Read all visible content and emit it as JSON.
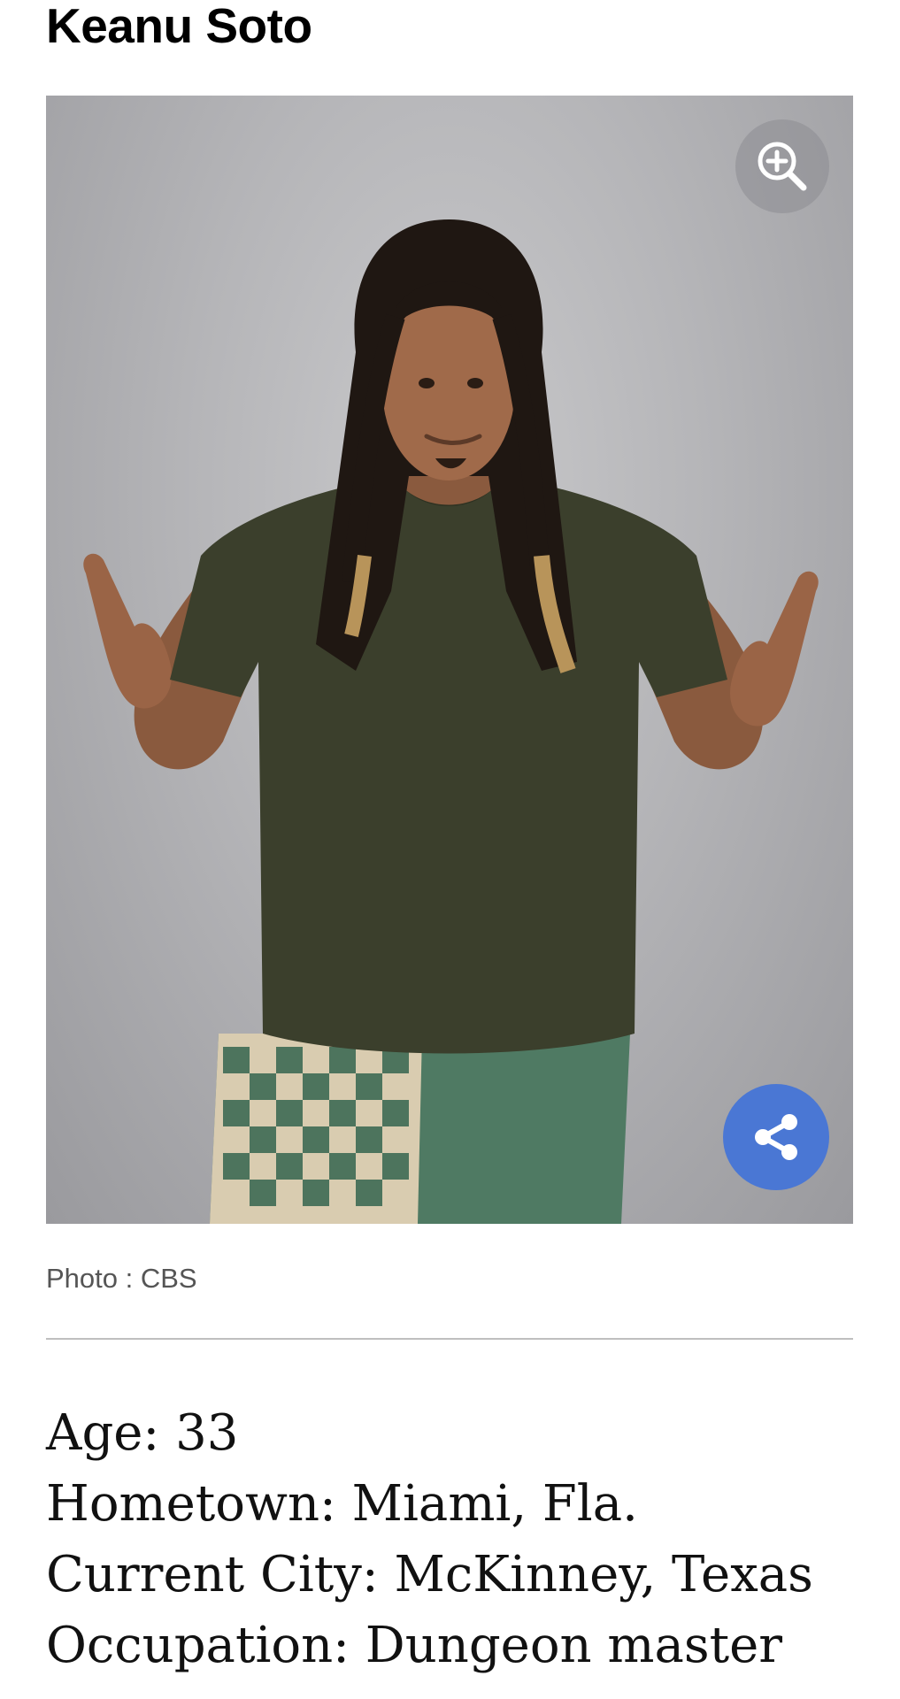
{
  "profile": {
    "name": "Keanu Soto",
    "photo_alt": "Keanu Soto",
    "photo_credit": "Photo : CBS"
  },
  "controls": {
    "zoom_icon": "zoom-in-icon",
    "share_icon": "share-icon",
    "share_color": "#4a77d4"
  },
  "details": [
    "Age: 33",
    "Hometown: Miami, Fla.",
    "Current City: McKinney, Texas",
    "Occupation: Dungeon master"
  ]
}
